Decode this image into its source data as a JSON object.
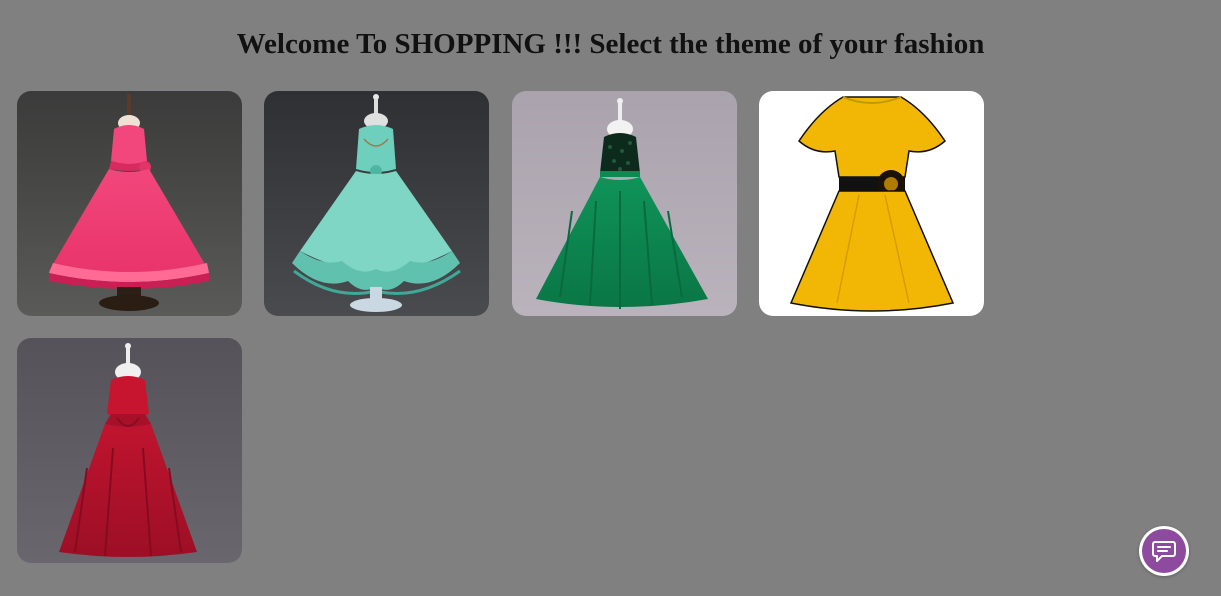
{
  "page": {
    "heading": "Welcome To SHOPPING !!! Select the theme of your fashion",
    "background_color": "#808080"
  },
  "themes": [
    {
      "name": "pink-tulle-dress",
      "color": "#e8336a",
      "icon": "dress-image"
    },
    {
      "name": "mint-ruffle-dress",
      "color": "#7fd6c5",
      "icon": "dress-image"
    },
    {
      "name": "green-sequin-dress",
      "color": "#0e8a52",
      "icon": "dress-image"
    },
    {
      "name": "yellow-flower-dress",
      "color": "#f2b705",
      "icon": "dress-image"
    },
    {
      "name": "red-satin-dress",
      "color": "#b0122a",
      "icon": "dress-image"
    }
  ],
  "chat": {
    "icon": "chat-bubble-icon",
    "color": "#8e4a9e"
  }
}
